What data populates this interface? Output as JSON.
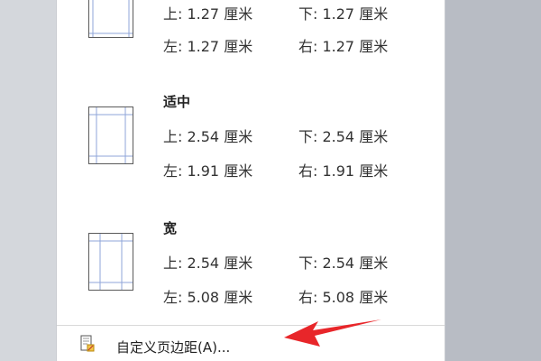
{
  "presets": [
    {
      "name": "",
      "top": "上: 1.27 厘米",
      "bottom": "下: 1.27 厘米",
      "left": "左: 1.27 厘米",
      "right": "右: 1.27 厘米"
    },
    {
      "name": "适中",
      "top": "上: 2.54 厘米",
      "bottom": "下: 2.54 厘米",
      "left": "左: 1.91 厘米",
      "right": "右: 1.91 厘米"
    },
    {
      "name": "宽",
      "top": "上: 2.54 厘米",
      "bottom": "下: 2.54 厘米",
      "left": "左: 5.08 厘米",
      "right": "右: 5.08 厘米"
    }
  ],
  "custom_margins": {
    "label": "自定义页边距(A)...",
    "icon": "page-setup-icon"
  },
  "annotation": {
    "icon": "red-arrow-icon",
    "color": "#e8262a"
  },
  "colors": {
    "guide": "#8fa6d8",
    "page_border": "#5a5a5a",
    "backdrop": "#b8bcc4"
  }
}
